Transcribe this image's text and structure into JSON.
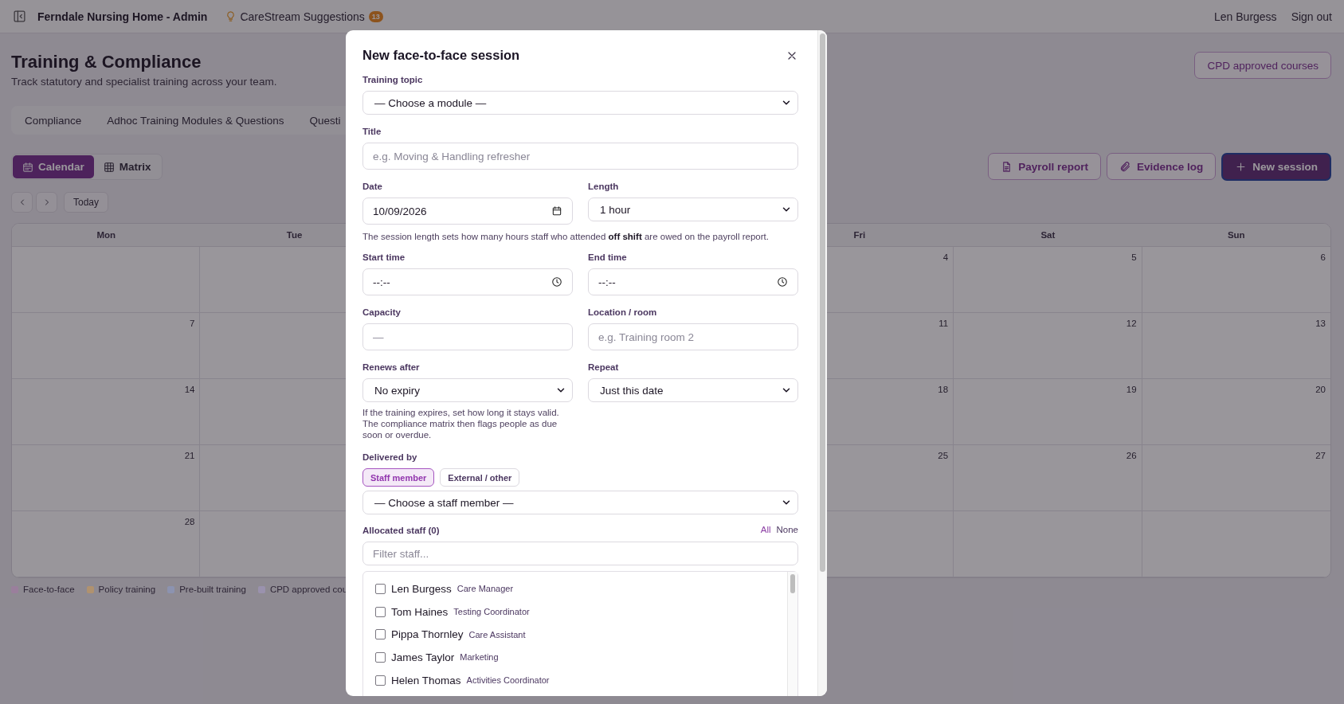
{
  "topbar": {
    "app_title": "Ferndale Nursing Home - Admin",
    "suggestions": {
      "label": "CareStream Suggestions",
      "count": "13"
    },
    "user": "Len Burgess",
    "sign_out": "Sign out"
  },
  "page": {
    "title": "Training & Compliance",
    "subtitle": "Track statutory and specialist training across your team.",
    "cpd_button": "CPD approved courses"
  },
  "tabs": [
    {
      "label": "Compliance"
    },
    {
      "label": "Adhoc Training Modules & Questions"
    },
    {
      "label": "Questi"
    }
  ],
  "view_toggle": [
    {
      "label": "Calendar",
      "selected": true
    },
    {
      "label": "Matrix",
      "selected": false
    }
  ],
  "actions": [
    {
      "label": "Payroll report",
      "kind": "outline"
    },
    {
      "label": "Evidence log",
      "kind": "outline"
    },
    {
      "label": "New session",
      "kind": "primary"
    }
  ],
  "today_button": "Today",
  "calendar": {
    "columns": {
      "mon": "Mon",
      "tue": "Tue",
      "fri": "Fri",
      "sat": "Sat",
      "sun": "Sun"
    },
    "weeks": [
      {
        "fri": "4",
        "sat": "5",
        "sun": "6"
      },
      {
        "mon": "7",
        "fri": "11",
        "sat": "12",
        "sun": "13"
      },
      {
        "mon": "14",
        "fri": "18",
        "sat": "19",
        "sun": "20"
      },
      {
        "mon": "21",
        "fri": "25",
        "sat": "26",
        "sun": "27"
      },
      {
        "mon": "28"
      }
    ]
  },
  "legend": [
    {
      "label": "Face-to-face",
      "color": "#9a7f9c"
    },
    {
      "label": "Policy training",
      "color": "#b0926f"
    },
    {
      "label": "Pre-built training",
      "color": "#8c93b0"
    },
    {
      "label": "CPD approved cou",
      "color": "#9a92ae"
    }
  ],
  "modal": {
    "title": "New face-to-face session",
    "rows": [
      {
        "fields": [
          {
            "kind": "select",
            "label": "Training topic",
            "value": "— Choose a module —"
          }
        ]
      },
      {
        "fields": [
          {
            "kind": "text",
            "label": "Title",
            "placeholder": "e.g. Moving & Handling refresher"
          }
        ]
      },
      {
        "fields": [
          {
            "kind": "date",
            "label": "Date",
            "value": "10/09/2026"
          },
          {
            "kind": "select",
            "label": "Length",
            "value": "1 hour"
          }
        ],
        "hint": "The session length sets how many hours staff who attended **off shift** are owed on the payroll report."
      },
      {
        "fields": [
          {
            "kind": "time",
            "label": "Start time",
            "value": "--:--"
          },
          {
            "kind": "time",
            "label": "End time",
            "value": "--:--"
          }
        ]
      },
      {
        "fields": [
          {
            "kind": "text",
            "label": "Capacity",
            "placeholder": "—"
          },
          {
            "kind": "text",
            "label": "Location / room",
            "placeholder": "e.g. Training room 2"
          }
        ]
      },
      {
        "fields": [
          {
            "kind": "select",
            "label": "Renews after",
            "value": "No expiry",
            "hint": "If the training expires, set how long it stays valid. The compliance matrix then flags people as due soon or overdue."
          },
          {
            "kind": "select",
            "label": "Repeat",
            "value": "Just this date"
          }
        ]
      }
    ],
    "delivered_by": {
      "label": "Delivered by",
      "options": [
        {
          "label": "Staff member",
          "selected": true
        },
        {
          "label": "External / other",
          "selected": false
        }
      ],
      "select": "— Choose a staff member —"
    },
    "staff": {
      "label": "Allocated staff (0)",
      "all": "All",
      "none": "None",
      "filter_placeholder": "Filter staff...",
      "items": [
        {
          "name": "Len Burgess",
          "role": "Care Manager",
          "checked": false
        },
        {
          "name": "Tom Haines",
          "role": "Testing Coordinator",
          "checked": false
        },
        {
          "name": "Pippa Thornley",
          "role": "Care Assistant",
          "checked": false
        },
        {
          "name": "James Taylor",
          "role": "Marketing",
          "checked": false
        },
        {
          "name": "Helen Thomas",
          "role": "Activities Coordinator",
          "checked": false
        }
      ]
    }
  }
}
